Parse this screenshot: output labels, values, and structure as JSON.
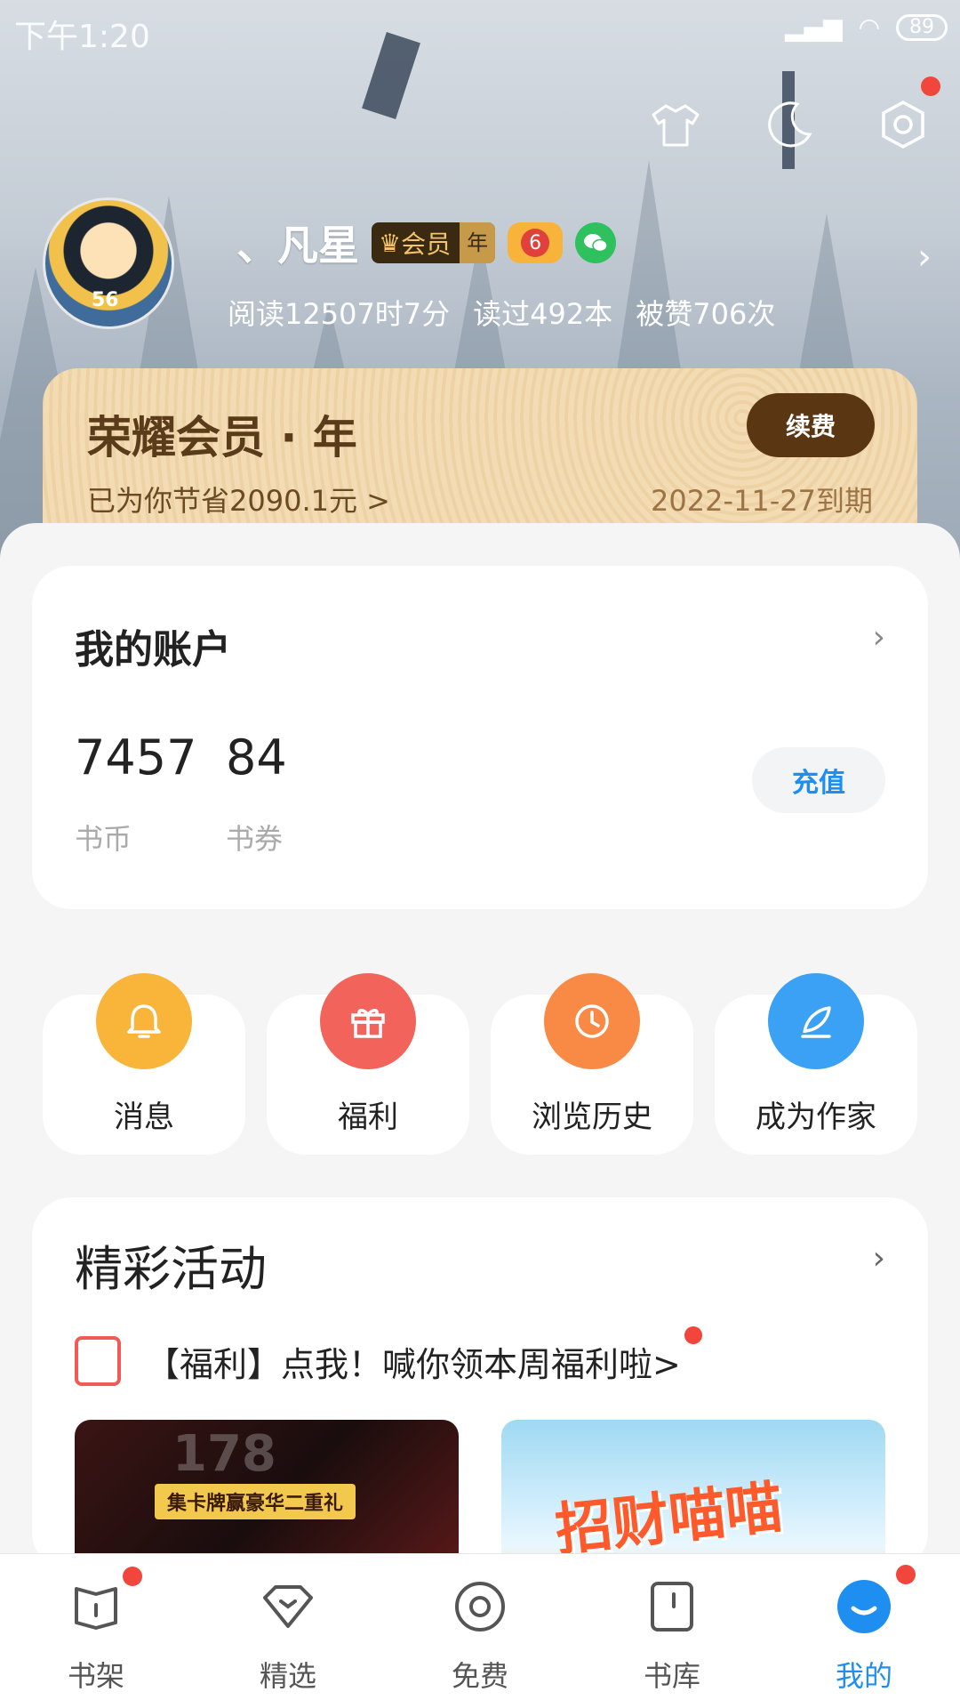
{
  "status_bar": {
    "time": "下午1:20",
    "battery": "89"
  },
  "header": {
    "icons": [
      "shirt-icon",
      "moon-icon",
      "settings-icon"
    ]
  },
  "profile": {
    "name": "、凡星",
    "vip_badge": "会员",
    "vip_badge_year": "年",
    "level": "6",
    "avatar_number": "56",
    "stats": {
      "read_time": "阅读12507时7分",
      "books_read": "读过492本",
      "likes": "被赞706次"
    }
  },
  "vip_card": {
    "title": "荣耀会员 · 年",
    "saved": "已为你节省2090.1元 >",
    "expire": "2022-11-27到期",
    "renew_label": "续费"
  },
  "account": {
    "title": "我的账户",
    "coins_value": "7457",
    "coins_label": "书币",
    "coupons_value": "84",
    "coupons_label": "书券",
    "recharge_label": "充值"
  },
  "shortcuts": [
    {
      "label": "消息",
      "icon": "bell-icon",
      "color": "#f9b43a"
    },
    {
      "label": "福利",
      "icon": "gift-icon",
      "color": "#f2645b"
    },
    {
      "label": "浏览历史",
      "icon": "clock-icon",
      "color": "#f98a46"
    },
    {
      "label": "成为作家",
      "icon": "quill-icon",
      "color": "#3aa1f4"
    }
  ],
  "activities": {
    "title": "精彩活动",
    "promo_text": "【福利】点我！喊你领本周福利啦>",
    "banner_left_tag": "集卡牌赢豪华二重礼",
    "banner_left_number": "178",
    "banner_right_text": "招财喵喵"
  },
  "tabbar": {
    "tabs": [
      {
        "label": "书架",
        "icon": "bookshelf-icon"
      },
      {
        "label": "精选",
        "icon": "featured-icon"
      },
      {
        "label": "免费",
        "icon": "free-icon"
      },
      {
        "label": "书库",
        "icon": "library-icon"
      },
      {
        "label": "我的",
        "icon": "me-icon"
      }
    ],
    "active": "我的"
  },
  "colors": {
    "accent": "#1e8ff0",
    "notification": "#f2453b",
    "vip_dark": "#5a3612"
  }
}
